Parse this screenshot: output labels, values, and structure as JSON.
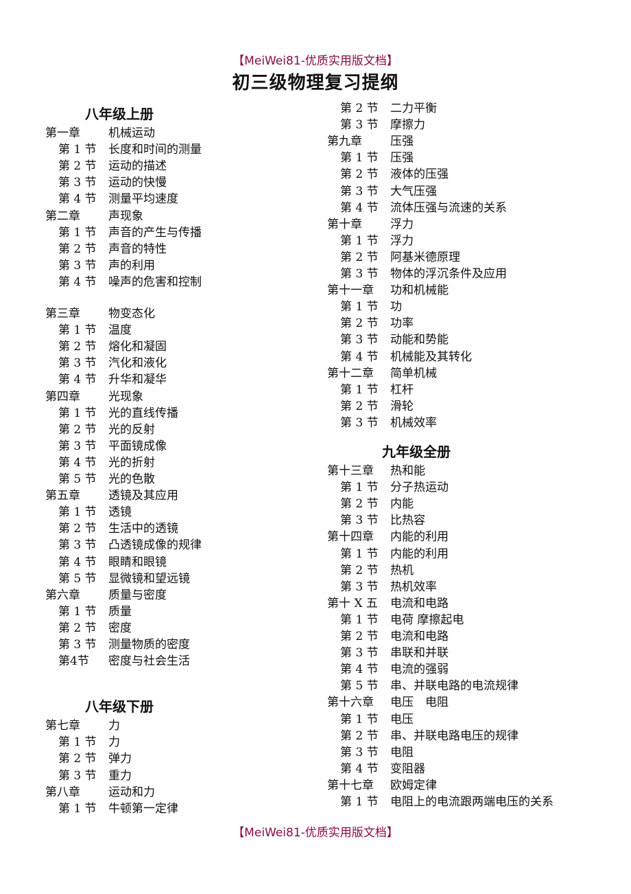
{
  "banner_text": "【MeiWei81-优质实用版文档】",
  "title": "初三级物理复习提纲",
  "left_column": [
    {
      "type": "grade",
      "text": "八年级上册"
    },
    {
      "type": "chapter",
      "label": "第一章",
      "text": "机械运动"
    },
    {
      "type": "section",
      "label": "第 1 节",
      "text": "长度和时间的测量"
    },
    {
      "type": "section",
      "label": "第 2 节",
      "text": "运动的描述"
    },
    {
      "type": "section",
      "label": "第 3 节",
      "text": "运动的快慢"
    },
    {
      "type": "section",
      "label": "第 4 节",
      "text": "测量平均速度"
    },
    {
      "type": "chapter",
      "label": "第二章",
      "text": "声现象"
    },
    {
      "type": "section",
      "label": "第 1 节",
      "text": "声音的产生与传播"
    },
    {
      "type": "section",
      "label": "第 2 节",
      "text": "声音的特性"
    },
    {
      "type": "section",
      "label": "第 3 节",
      "text": "声的利用"
    },
    {
      "type": "section",
      "label": "第 4 节",
      "text": "噪声的危害和控制"
    },
    {
      "type": "chapter",
      "label": "第三章",
      "text": "物变态化"
    },
    {
      "type": "section",
      "label": "第 1 节",
      "text": "温度"
    },
    {
      "type": "section",
      "label": "第 2 节",
      "text": "熔化和凝固"
    },
    {
      "type": "section",
      "label": "第 3 节",
      "text": "汽化和液化"
    },
    {
      "type": "section",
      "label": "第 4 节",
      "text": "升华和凝华"
    },
    {
      "type": "chapter",
      "label": "第四章",
      "text": "光现象"
    },
    {
      "type": "section",
      "label": "第 1 节",
      "text": "光的直线传播"
    },
    {
      "type": "section",
      "label": "第 2 节",
      "text": "光的反射"
    },
    {
      "type": "section",
      "label": "第 3 节",
      "text": "平面镜成像"
    },
    {
      "type": "section",
      "label": "第 4 节",
      "text": "光的折射"
    },
    {
      "type": "section",
      "label": "第 5 节",
      "text": "光的色散"
    },
    {
      "type": "chapter",
      "label": "第五章",
      "text": "透镜及其应用"
    },
    {
      "type": "section",
      "label": "第 1 节",
      "text": "透镜"
    },
    {
      "type": "section",
      "label": "第 2 节",
      "text": "生活中的透镜"
    },
    {
      "type": "section",
      "label": "第 3 节",
      "text": "凸透镜成像的规律"
    },
    {
      "type": "section",
      "label": "第 4 节",
      "text": "眼睛和眼镜"
    },
    {
      "type": "section",
      "label": "第 5 节",
      "text": "显微镜和望远镜"
    },
    {
      "type": "chapter",
      "label": "第六章",
      "text": "质量与密度"
    },
    {
      "type": "section",
      "label": "第 1 节",
      "text": "质量"
    },
    {
      "type": "section",
      "label": "第 2 节",
      "text": "密度"
    },
    {
      "type": "section",
      "label": "第 3 节",
      "text": "测量物质的密度"
    },
    {
      "type": "section",
      "label": "第4节",
      "text": "密度与社会生活"
    },
    {
      "type": "grade",
      "text": "八年级下册"
    },
    {
      "type": "chapter",
      "label": "第七章",
      "text": "力"
    },
    {
      "type": "section",
      "label": "第 1 节",
      "text": "力"
    },
    {
      "type": "section",
      "label": "第 2 节",
      "text": "弹力"
    },
    {
      "type": "section",
      "label": "第 3 节",
      "text": "重力"
    },
    {
      "type": "chapter",
      "label": "第八章",
      "text": "运动和力"
    },
    {
      "type": "section",
      "label": "第 1 节",
      "text": "牛顿第一定律"
    }
  ],
  "right_column": [
    {
      "type": "section",
      "label": "第 2 节",
      "text": "二力平衡"
    },
    {
      "type": "section",
      "label": "第 3 节",
      "text": "摩擦力"
    },
    {
      "type": "chapter",
      "label": "第九章",
      "text": "压强"
    },
    {
      "type": "section",
      "label": "第 1 节",
      "text": "压强"
    },
    {
      "type": "section",
      "label": "第 2 节",
      "text": "液体的压强"
    },
    {
      "type": "section",
      "label": "第 3 节",
      "text": "大气压强"
    },
    {
      "type": "section",
      "label": "第 4 节",
      "text": "流体压强与流速的关系"
    },
    {
      "type": "chapter",
      "label": "第十章",
      "text": "浮力"
    },
    {
      "type": "section",
      "label": "第 1 节",
      "text": "浮力"
    },
    {
      "type": "section",
      "label": "第 2 节",
      "text": "阿基米德原理"
    },
    {
      "type": "section",
      "label": "第 3 节",
      "text": "物体的浮沉条件及应用"
    },
    {
      "type": "chapter",
      "label": "第十一章",
      "text": "功和机械能"
    },
    {
      "type": "section",
      "label": "第 1 节",
      "text": "功"
    },
    {
      "type": "section",
      "label": "第 2 节",
      "text": "功率"
    },
    {
      "type": "section",
      "label": "第 3 节",
      "text": "动能和势能"
    },
    {
      "type": "section",
      "label": "第 4 节",
      "text": "机械能及其转化"
    },
    {
      "type": "chapter",
      "label": "第十二章",
      "text": "简单机械"
    },
    {
      "type": "section",
      "label": "第 1 节",
      "text": "杠杆"
    },
    {
      "type": "section",
      "label": "第 2 节",
      "text": "滑轮"
    },
    {
      "type": "section",
      "label": "第 3 节",
      "text": "机械效率"
    },
    {
      "type": "grade",
      "text": "九年级全册"
    },
    {
      "type": "chapter",
      "label": "第十三章",
      "text": "热和能"
    },
    {
      "type": "section",
      "label": "第 1 节",
      "text": "分子热运动"
    },
    {
      "type": "section",
      "label": "第 2 节",
      "text": "内能"
    },
    {
      "type": "section",
      "label": "第 3 节",
      "text": "比热容"
    },
    {
      "type": "chapter",
      "label": "第十四章",
      "text": "内能的利用"
    },
    {
      "type": "section",
      "label": "第 1 节",
      "text": "内能的利用"
    },
    {
      "type": "section",
      "label": "第 2 节",
      "text": "热机"
    },
    {
      "type": "section",
      "label": "第 3 节",
      "text": "热机效率"
    },
    {
      "type": "chapter",
      "label": "第十 X 五",
      "text": "电流和电路"
    },
    {
      "type": "section",
      "label": "第 1 节",
      "text": "电荷  摩擦起电"
    },
    {
      "type": "section",
      "label": "第 2 节",
      "text": "电流和电路"
    },
    {
      "type": "section",
      "label": "第 3 节",
      "text": "串联和并联"
    },
    {
      "type": "section",
      "label": "第 4 节",
      "text": "电流的强弱"
    },
    {
      "type": "section",
      "label": "第 5 节",
      "text": "串、并联电路的电流规律"
    },
    {
      "type": "chapter",
      "label": "第十六章",
      "text": "电压　电阻"
    },
    {
      "type": "section",
      "label": "第 1 节",
      "text": "电压"
    },
    {
      "type": "section",
      "label": "第 2 节",
      "text": "串、并联电路电压的规律"
    },
    {
      "type": "section",
      "label": "第 3 节",
      "text": "电阻"
    },
    {
      "type": "section",
      "label": "第 4 节",
      "text": "变阻器"
    },
    {
      "type": "chapter",
      "label": "第十七章",
      "text": "欧姆定律"
    },
    {
      "type": "section",
      "label": "第 1 节",
      "text": "电阻上的电流跟两端电压的关系"
    }
  ]
}
